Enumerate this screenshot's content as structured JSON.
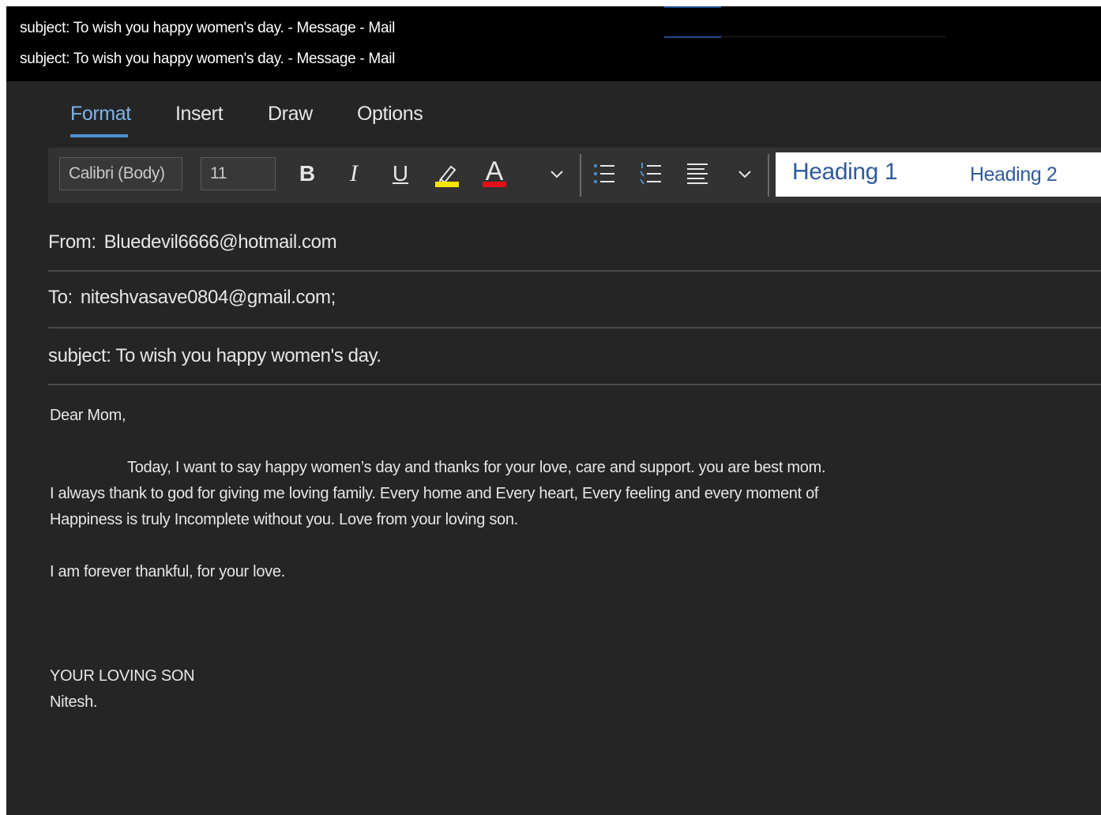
{
  "window": {
    "title_lines": [
      "subject: To wish you happy women's day. - Message - Mail",
      "subject: To wish you happy women's day. - Message - Mail"
    ]
  },
  "tabs": [
    {
      "label": "Format",
      "active": true
    },
    {
      "label": "Insert",
      "active": false
    },
    {
      "label": "Draw",
      "active": false
    },
    {
      "label": "Options",
      "active": false
    }
  ],
  "ribbon": {
    "font_name": "Calibri (Body)",
    "font_size": "11",
    "bold_label": "B",
    "italic_label": "I",
    "underline_label": "U",
    "font_color_label": "A",
    "highlight_color": "#f5e300",
    "font_color": "#e0101a",
    "styles": [
      "Heading 1",
      "Heading 2"
    ]
  },
  "header": {
    "from_label": "From:",
    "from_value": "Bluedevil6666@hotmail.com",
    "to_label": "To:",
    "to_value": "niteshvasave0804@gmail.com;",
    "subject": "subject: To wish you happy women's day."
  },
  "body": {
    "greeting": "Dear Mom,",
    "paragraph_lines": [
      "Today, I want to say happy women’s day and thanks for your love, care and support. you are  best mom.",
      "I always thank to god for giving me loving family. Every home and Every heart, Every feeling and every moment of",
      "Happiness is truly Incomplete without you. Love from your loving son."
    ],
    "closing_line": "I am forever thankful, for your love.",
    "signature_lines": [
      "YOUR LOVING SON",
      "Nitesh."
    ]
  }
}
